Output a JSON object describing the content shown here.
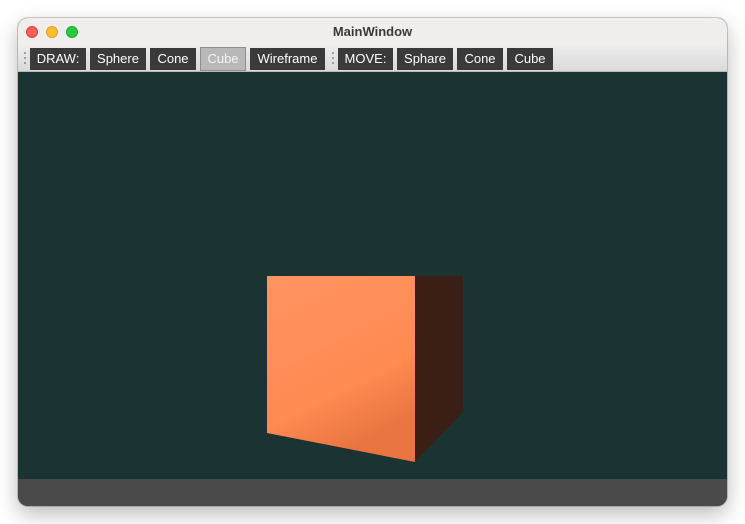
{
  "window": {
    "title": "MainWindow"
  },
  "toolbar": {
    "draw_label": "DRAW:",
    "draw_buttons": {
      "sphere": "Sphere",
      "cone": "Cone",
      "cube": "Cube",
      "wireframe": "Wireframe"
    },
    "active_draw": "Cube",
    "move_label": "MOVE:",
    "move_buttons": {
      "sphere": "Sphare",
      "cone": "Cone",
      "cube": "Cube"
    }
  },
  "scene": {
    "background_color": "#1b3333",
    "object": "cube",
    "front_face_color": "#ff8b55",
    "side_face_color": "#3b1f14",
    "statusbar_color": "#4a4a4a"
  }
}
